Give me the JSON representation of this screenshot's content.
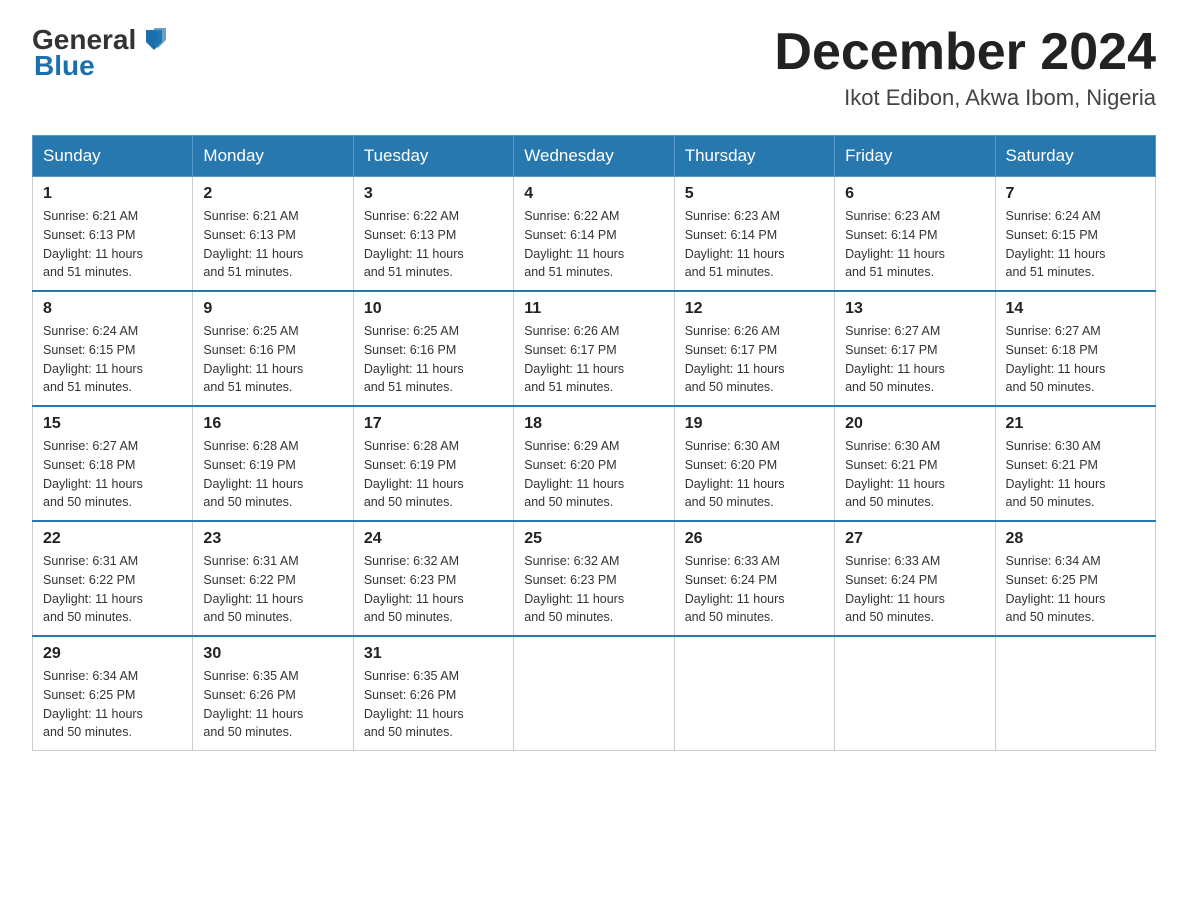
{
  "header": {
    "logo_general": "General",
    "logo_blue": "Blue",
    "month_title": "December 2024",
    "location": "Ikot Edibon, Akwa Ibom, Nigeria"
  },
  "weekdays": [
    "Sunday",
    "Monday",
    "Tuesday",
    "Wednesday",
    "Thursday",
    "Friday",
    "Saturday"
  ],
  "weeks": [
    [
      {
        "day": "1",
        "sunrise": "6:21 AM",
        "sunset": "6:13 PM",
        "daylight": "11 hours and 51 minutes."
      },
      {
        "day": "2",
        "sunrise": "6:21 AM",
        "sunset": "6:13 PM",
        "daylight": "11 hours and 51 minutes."
      },
      {
        "day": "3",
        "sunrise": "6:22 AM",
        "sunset": "6:13 PM",
        "daylight": "11 hours and 51 minutes."
      },
      {
        "day": "4",
        "sunrise": "6:22 AM",
        "sunset": "6:14 PM",
        "daylight": "11 hours and 51 minutes."
      },
      {
        "day": "5",
        "sunrise": "6:23 AM",
        "sunset": "6:14 PM",
        "daylight": "11 hours and 51 minutes."
      },
      {
        "day": "6",
        "sunrise": "6:23 AM",
        "sunset": "6:14 PM",
        "daylight": "11 hours and 51 minutes."
      },
      {
        "day": "7",
        "sunrise": "6:24 AM",
        "sunset": "6:15 PM",
        "daylight": "11 hours and 51 minutes."
      }
    ],
    [
      {
        "day": "8",
        "sunrise": "6:24 AM",
        "sunset": "6:15 PM",
        "daylight": "11 hours and 51 minutes."
      },
      {
        "day": "9",
        "sunrise": "6:25 AM",
        "sunset": "6:16 PM",
        "daylight": "11 hours and 51 minutes."
      },
      {
        "day": "10",
        "sunrise": "6:25 AM",
        "sunset": "6:16 PM",
        "daylight": "11 hours and 51 minutes."
      },
      {
        "day": "11",
        "sunrise": "6:26 AM",
        "sunset": "6:17 PM",
        "daylight": "11 hours and 51 minutes."
      },
      {
        "day": "12",
        "sunrise": "6:26 AM",
        "sunset": "6:17 PM",
        "daylight": "11 hours and 50 minutes."
      },
      {
        "day": "13",
        "sunrise": "6:27 AM",
        "sunset": "6:17 PM",
        "daylight": "11 hours and 50 minutes."
      },
      {
        "day": "14",
        "sunrise": "6:27 AM",
        "sunset": "6:18 PM",
        "daylight": "11 hours and 50 minutes."
      }
    ],
    [
      {
        "day": "15",
        "sunrise": "6:27 AM",
        "sunset": "6:18 PM",
        "daylight": "11 hours and 50 minutes."
      },
      {
        "day": "16",
        "sunrise": "6:28 AM",
        "sunset": "6:19 PM",
        "daylight": "11 hours and 50 minutes."
      },
      {
        "day": "17",
        "sunrise": "6:28 AM",
        "sunset": "6:19 PM",
        "daylight": "11 hours and 50 minutes."
      },
      {
        "day": "18",
        "sunrise": "6:29 AM",
        "sunset": "6:20 PM",
        "daylight": "11 hours and 50 minutes."
      },
      {
        "day": "19",
        "sunrise": "6:30 AM",
        "sunset": "6:20 PM",
        "daylight": "11 hours and 50 minutes."
      },
      {
        "day": "20",
        "sunrise": "6:30 AM",
        "sunset": "6:21 PM",
        "daylight": "11 hours and 50 minutes."
      },
      {
        "day": "21",
        "sunrise": "6:30 AM",
        "sunset": "6:21 PM",
        "daylight": "11 hours and 50 minutes."
      }
    ],
    [
      {
        "day": "22",
        "sunrise": "6:31 AM",
        "sunset": "6:22 PM",
        "daylight": "11 hours and 50 minutes."
      },
      {
        "day": "23",
        "sunrise": "6:31 AM",
        "sunset": "6:22 PM",
        "daylight": "11 hours and 50 minutes."
      },
      {
        "day": "24",
        "sunrise": "6:32 AM",
        "sunset": "6:23 PM",
        "daylight": "11 hours and 50 minutes."
      },
      {
        "day": "25",
        "sunrise": "6:32 AM",
        "sunset": "6:23 PM",
        "daylight": "11 hours and 50 minutes."
      },
      {
        "day": "26",
        "sunrise": "6:33 AM",
        "sunset": "6:24 PM",
        "daylight": "11 hours and 50 minutes."
      },
      {
        "day": "27",
        "sunrise": "6:33 AM",
        "sunset": "6:24 PM",
        "daylight": "11 hours and 50 minutes."
      },
      {
        "day": "28",
        "sunrise": "6:34 AM",
        "sunset": "6:25 PM",
        "daylight": "11 hours and 50 minutes."
      }
    ],
    [
      {
        "day": "29",
        "sunrise": "6:34 AM",
        "sunset": "6:25 PM",
        "daylight": "11 hours and 50 minutes."
      },
      {
        "day": "30",
        "sunrise": "6:35 AM",
        "sunset": "6:26 PM",
        "daylight": "11 hours and 50 minutes."
      },
      {
        "day": "31",
        "sunrise": "6:35 AM",
        "sunset": "6:26 PM",
        "daylight": "11 hours and 50 minutes."
      },
      null,
      null,
      null,
      null
    ]
  ],
  "labels": {
    "sunrise": "Sunrise:",
    "sunset": "Sunset:",
    "daylight": "Daylight:"
  }
}
